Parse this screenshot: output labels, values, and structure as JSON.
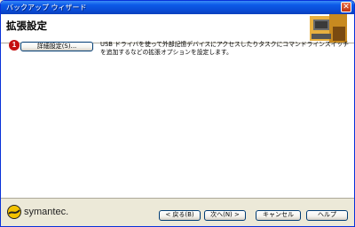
{
  "window": {
    "title": "バックアップ ウィザード",
    "close_glyph": "✕"
  },
  "header": {
    "title": "拡張設定"
  },
  "main": {
    "step_badge": "1",
    "advanced_button_label": "詳細設定(S)...",
    "description": "USB ドライバを使って外部記憶デバイスにアクセスしたりタスクにコマンドラインスイッチを追加するなどの拡張オプションを設定します。"
  },
  "footer": {
    "logo_text": "symantec.",
    "back_label": "< 戻る(B)",
    "next_label": "次へ(N) >",
    "cancel_label": "キャンセル",
    "help_label": "ヘルプ"
  },
  "colors": {
    "titlebar": "#0a4cd6",
    "badge": "#c51010",
    "logo_yellow": "#f2c200"
  }
}
